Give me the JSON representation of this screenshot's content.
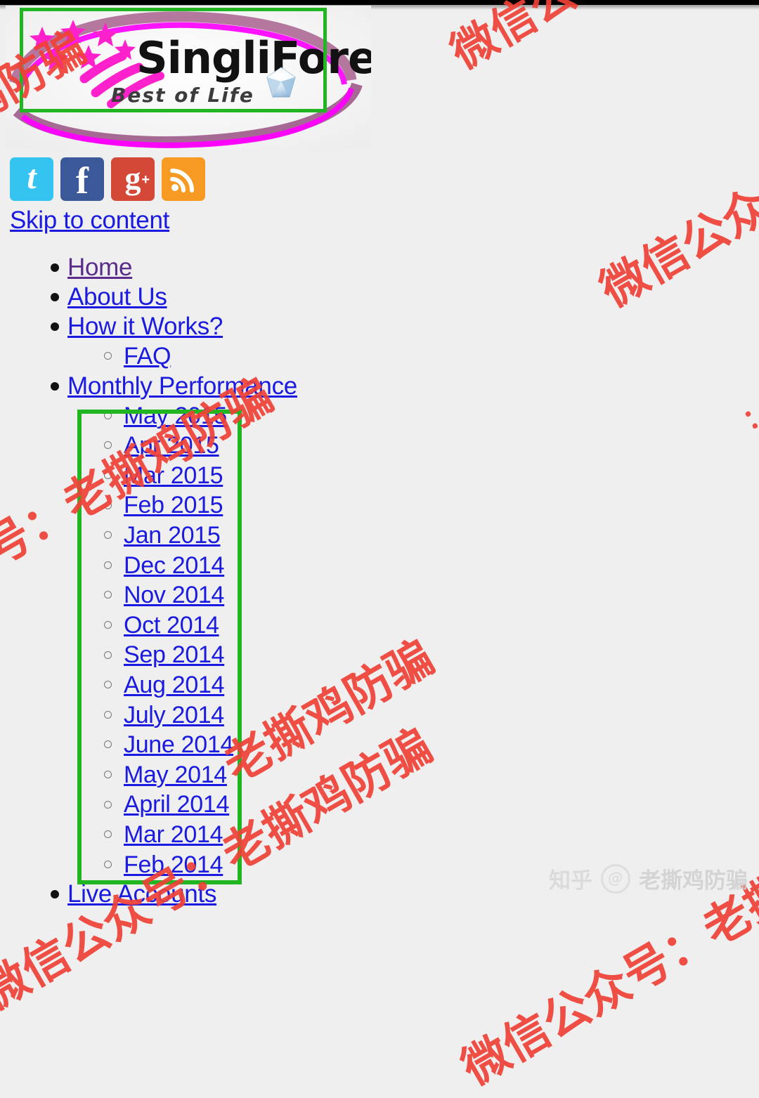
{
  "site": {
    "logo_title": "SingliForex",
    "logo_tagline": "Best of Life",
    "background_color": "#efefef",
    "link_color": "#1a1ae0",
    "visited_link_color": "#5a2d8c",
    "highlight_box_color": "#22b522"
  },
  "social": [
    {
      "name": "twitter",
      "glyph": "t",
      "label": "Twitter",
      "color": "#35c3f0"
    },
    {
      "name": "facebook",
      "glyph": "f",
      "label": "Facebook",
      "color": "#3b5998"
    },
    {
      "name": "google-plus",
      "glyph": "g",
      "plus": "+",
      "label": "Google Plus",
      "color": "#d34836"
    },
    {
      "name": "rss",
      "glyph": "",
      "label": "RSS Feed",
      "color": "#f69a23"
    }
  ],
  "skip_link": "Skip to content",
  "nav": [
    {
      "label": "Home",
      "visited": true
    },
    {
      "label": "About Us",
      "visited": false
    },
    {
      "label": "How it Works?",
      "visited": false
    },
    {
      "label": "Monthly Performance",
      "visited": false
    },
    {
      "label": "Live Accounts",
      "visited": false
    }
  ],
  "how_it_works_children": [
    {
      "label": "FAQ"
    }
  ],
  "monthly_performance_children": [
    {
      "label": "May 2015"
    },
    {
      "label": "Apr 2015"
    },
    {
      "label": "Mar 2015"
    },
    {
      "label": "Feb 2015"
    },
    {
      "label": "Jan 2015"
    },
    {
      "label": "Dec 2014"
    },
    {
      "label": "Nov 2014"
    },
    {
      "label": "Oct 2014"
    },
    {
      "label": "Sep 2014"
    },
    {
      "label": "Aug 2014"
    },
    {
      "label": "July 2014"
    },
    {
      "label": "June 2014"
    },
    {
      "label": "May 2014"
    },
    {
      "label": "April 2014"
    },
    {
      "label": "Mar 2014"
    },
    {
      "label": "Feb 2014"
    }
  ],
  "watermarks": {
    "full_text": "微信公众号：老撕鸡防骗",
    "color": "#ef4136",
    "fragments": [
      {
        "id": "a",
        "text": "鸡防骗"
      },
      {
        "id": "b",
        "text": "微信公"
      },
      {
        "id": "c",
        "text": "号：老撕鸡防骗"
      },
      {
        "id": "d",
        "text": "微信公众"
      },
      {
        "id": "e",
        "text": "老撕鸡防骗"
      },
      {
        "id": "f",
        "text": "微信公众号：老撕鸡防骗"
      },
      {
        "id": "g",
        "text": "微信公众号：老撕鸡防骗"
      },
      {
        "id": "h",
        "text": "："
      }
    ]
  },
  "zhihu_credit": {
    "mark": "知乎",
    "at": "@",
    "name": "老撕鸡防骗"
  }
}
